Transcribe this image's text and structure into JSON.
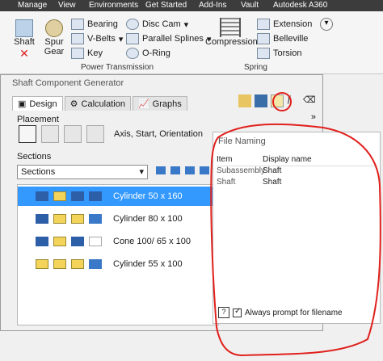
{
  "menubar": {
    "items": [
      "Manage",
      "View",
      "Environments",
      "Get Started",
      "Add-Ins",
      "Vault",
      "Autodesk A360"
    ]
  },
  "ribbon": {
    "shaft": "Shaft",
    "spur_gear": "Spur\nGear",
    "bearing": "Bearing",
    "vbelts": "V-Belts",
    "key": "Key",
    "disc_cam": "Disc Cam",
    "parallel_splines": "Parallel Splines",
    "oring": "O-Ring",
    "compression": "Compression",
    "extension": "Extension",
    "belleville": "Belleville",
    "torsion": "Torsion",
    "group_power": "Power Transmission",
    "group_spring": "Spring"
  },
  "dialog": {
    "title": "Shaft Component Generator",
    "tabs": [
      "Design",
      "Calculation",
      "Graphs"
    ],
    "placement_label": "Placement",
    "placement_text": "Axis, Start, Orientation",
    "sections_label": "Sections",
    "sections_combo": "Sections",
    "rows": [
      "Cylinder 50 x 160",
      "Cylinder 80 x 100",
      "Cone 100/ 65 x 100",
      "Cylinder 55 x 100"
    ]
  },
  "naming": {
    "title": "File Naming",
    "headers": [
      "Item",
      "Display name"
    ],
    "rows": [
      [
        "Subassembly",
        "Shaft"
      ],
      [
        "Shaft",
        "Shaft"
      ]
    ],
    "checkbox": "Always prompt for filename"
  }
}
